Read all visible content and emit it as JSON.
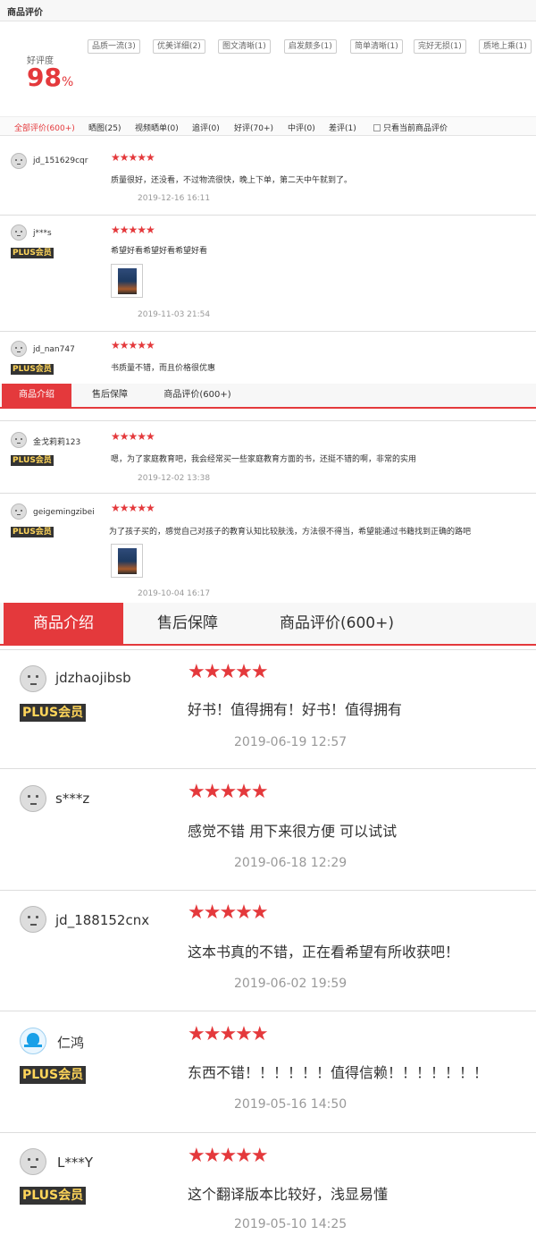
{
  "header": {
    "title": "商品评价"
  },
  "rating": {
    "label": "好评度",
    "value": "98",
    "unit": "%"
  },
  "tags": [
    "品质一流(3)",
    "优美详细(2)",
    "图文清晰(1)",
    "启发颇多(1)",
    "简单清晰(1)",
    "完好无损(1)",
    "质地上乘(1)"
  ],
  "filters": {
    "all": "全部评价(600+)",
    "pics": "晒图(25)",
    "video": "视频晒单(0)",
    "follow": "追评(0)",
    "good": "好评(70+)",
    "mid": "中评(0)",
    "bad": "差评(1)",
    "current_only": "只看当前商品评价"
  },
  "tabs": {
    "intro": "商品介绍",
    "after_sale": "售后保障",
    "reviews": "商品评价(600+)"
  },
  "stars_text": "★★★★★",
  "plus_label": "PLUS会员",
  "reviews_small_a": [
    {
      "user": "jd_151629cqr",
      "text": "质量很好，还没看，不过物流很快，晚上下单，第二天中午就到了。",
      "time": "2019-12-16 16:11"
    },
    {
      "user": "j***s",
      "text": "希望好看希望好看希望好看",
      "time": "2019-11-03 21:54"
    },
    {
      "user": "jd_nan747",
      "text": "书质量不错，而且价格很优惠"
    }
  ],
  "reviews_small_b": [
    {
      "user": "金戈莉莉123",
      "text": "嗯，为了家庭教育吧，我会经常买一些家庭教育方面的书，还挺不错的啊，非常的实用",
      "time": "2019-12-02 13:38"
    },
    {
      "user": "geigemingzibei",
      "text": "为了孩子买的，感觉自己对孩子的教育认知比较肤浅，方法很不得当，希望能通过书籍找到正确的路吧",
      "time": "2019-10-04 16:17"
    }
  ],
  "reviews_big": [
    {
      "user": "jdzhaojibsb",
      "text": "好书！值得拥有！好书！值得拥有",
      "time": "2019-06-19 12:57"
    },
    {
      "user": "s***z",
      "text": "感觉不错 用下来很方便 可以试试",
      "time": "2019-06-18 12:29"
    },
    {
      "user": "jd_188152cnx",
      "text": "这本书真的不错，正在看希望有所收获吧！",
      "time": "2019-06-02 19:59"
    },
    {
      "user": "仁鸿",
      "text": "东西不错！！！！！！值得信赖！！！！！！！",
      "time": "2019-05-16 14:50"
    },
    {
      "user": "L***Y",
      "text": "这个翻译版本比较好，浅显易懂",
      "time": "2019-05-10 14:25"
    }
  ]
}
